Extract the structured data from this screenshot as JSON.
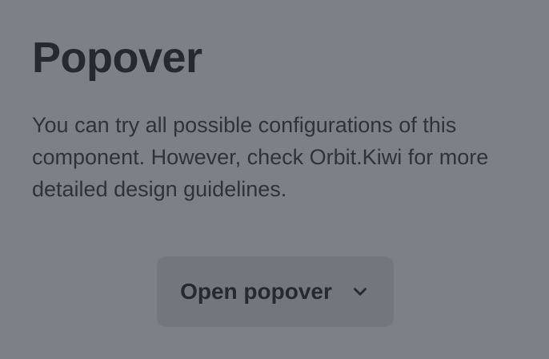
{
  "heading": {
    "title": "Popover"
  },
  "description": {
    "text": "You can try all possible configurations of this component. However, check Orbit.Kiwi for more detailed design guidelines."
  },
  "popover_button": {
    "label": "Open popover",
    "icon": "chevron-down-icon"
  },
  "colors": {
    "overlay_background": "#7d8087",
    "button_background": "#72767d",
    "text": "#252a31"
  }
}
